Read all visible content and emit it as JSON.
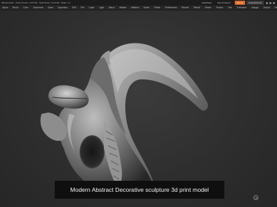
{
  "titlebar": {
    "status": "ZBrush Mode · Active Points: 1.012 Mil · Total Points: 4.112 Mil · Scale: 1.0",
    "menu_label": "QuickSave",
    "see_through": "See-through 0",
    "menus_button": "Menus",
    "script_button": "DefaultZScript"
  },
  "menubar": {
    "items": [
      "Alpha",
      "Brush",
      "Color",
      "Document",
      "Draw",
      "Dynamics",
      "Edit",
      "File",
      "Layer",
      "Light",
      "Macro",
      "Marker",
      "Material",
      "Movie",
      "Picker",
      "Preferences",
      "Render",
      "Stencil",
      "Stroke",
      "Texture",
      "Tool",
      "Transform",
      "Zplugin",
      "Zscript",
      "Help"
    ]
  },
  "viewport": {
    "caption": "Modern Abstract Decorative sculpture 3d print model"
  },
  "colors": {
    "accent": "#d86a2a",
    "viewport_bg": "#2e2e2e",
    "caption_bg": "#0f0f0f"
  },
  "icons": {
    "navigation": "orbit-icon"
  }
}
